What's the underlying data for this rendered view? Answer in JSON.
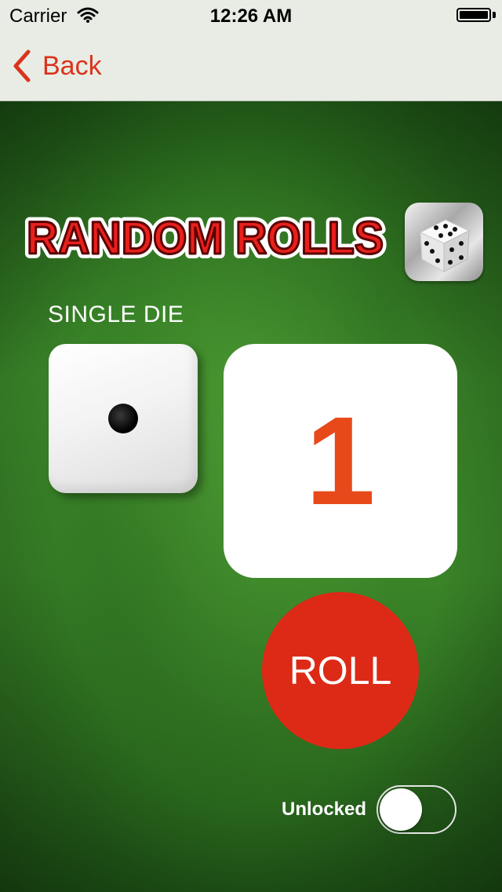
{
  "status_bar": {
    "carrier": "Carrier",
    "time": "12:26 AM"
  },
  "nav": {
    "back_label": "Back"
  },
  "logo": {
    "title": "RANDOM ROLLS"
  },
  "game": {
    "mode_label": "SINGLE DIE",
    "die_face": 1,
    "result": "1",
    "roll_label": "ROLL"
  },
  "unlock": {
    "label": "Unlocked",
    "state": "off"
  },
  "colors": {
    "accent_red": "#dc2a16",
    "result_orange": "#e8491a",
    "felt_green": "#2c6b20",
    "nav_bg": "#e8ece5",
    "back_tint": "#d9341c"
  }
}
